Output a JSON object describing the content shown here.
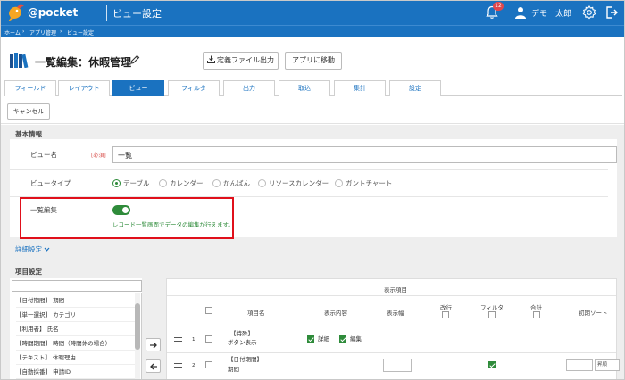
{
  "header": {
    "logo_text": "@pocket",
    "app_title": "ビュー設定",
    "notification_count": "12",
    "user_name": "デモ　太郎"
  },
  "breadcrumb": [
    "ホーム",
    "›",
    "アプリ管理",
    "›",
    "ビュー設定"
  ],
  "page": {
    "title": "一覧編集：休暇管理",
    "def_file_button": "定義ファイル出力",
    "go_app_button": "アプリに移動"
  },
  "tabs": [
    {
      "label": "フィールド",
      "active": false
    },
    {
      "label": "レイアウト",
      "active": false
    },
    {
      "label": "ビュー",
      "active": true
    },
    {
      "label": "フィルタ",
      "active": false
    },
    {
      "label": "出力",
      "active": false
    },
    {
      "label": "取込",
      "active": false
    },
    {
      "label": "集計",
      "active": false
    },
    {
      "label": "設定",
      "active": false
    }
  ],
  "cancel_button": "キャンセル",
  "basic": {
    "section_label": "基本情報",
    "view_name_label": "ビュー名",
    "required_badge": "[必須]",
    "view_name_value": "一覧",
    "view_type_label": "ビュータイプ",
    "view_types": [
      {
        "label": "テーブル",
        "selected": true
      },
      {
        "label": "カレンダー",
        "selected": false
      },
      {
        "label": "かんばん",
        "selected": false
      },
      {
        "label": "リソースカレンダー",
        "selected": false
      },
      {
        "label": "ガントチャート",
        "selected": false
      }
    ],
    "bulk_edit_label": "一覧編集",
    "bulk_edit_on": true,
    "bulk_edit_hint": "レコード一覧画面でデータの編集が行えます。"
  },
  "detail_link": "詳細設定",
  "items": {
    "section_label": "項目設定",
    "search_value": "",
    "list": [
      "【日付期間】 期間",
      "【単一選択】 カテゴリ",
      "【利用者】 氏名",
      "【時間期間】 時間（時間休の場合）",
      "【テキスト】 休暇理由",
      "【自動採番】 申請ID"
    ],
    "grid": {
      "group_header": "表示項目",
      "headers": {
        "item_name": "項目名",
        "display": "表示内容",
        "width": "表示幅",
        "wrap": "改行",
        "filter": "フィルタ",
        "total": "合計",
        "initial_sort": "初期ソート"
      },
      "rows": [
        {
          "no": "1",
          "name_line1": "【特殊】",
          "name_line2": "ボタン表示",
          "detail_label": "詳細",
          "edit_label": "編集",
          "detail_checked": true,
          "edit_checked": true
        },
        {
          "no": "2",
          "name_line1": "【日付期間】",
          "name_line2": "期間",
          "filter_checked": true,
          "sort_value": "昇順"
        }
      ]
    }
  },
  "colors": {
    "brand_blue": "#1a72c0",
    "accent_green": "#2e8b3a",
    "highlight_red": "#e0101b"
  }
}
